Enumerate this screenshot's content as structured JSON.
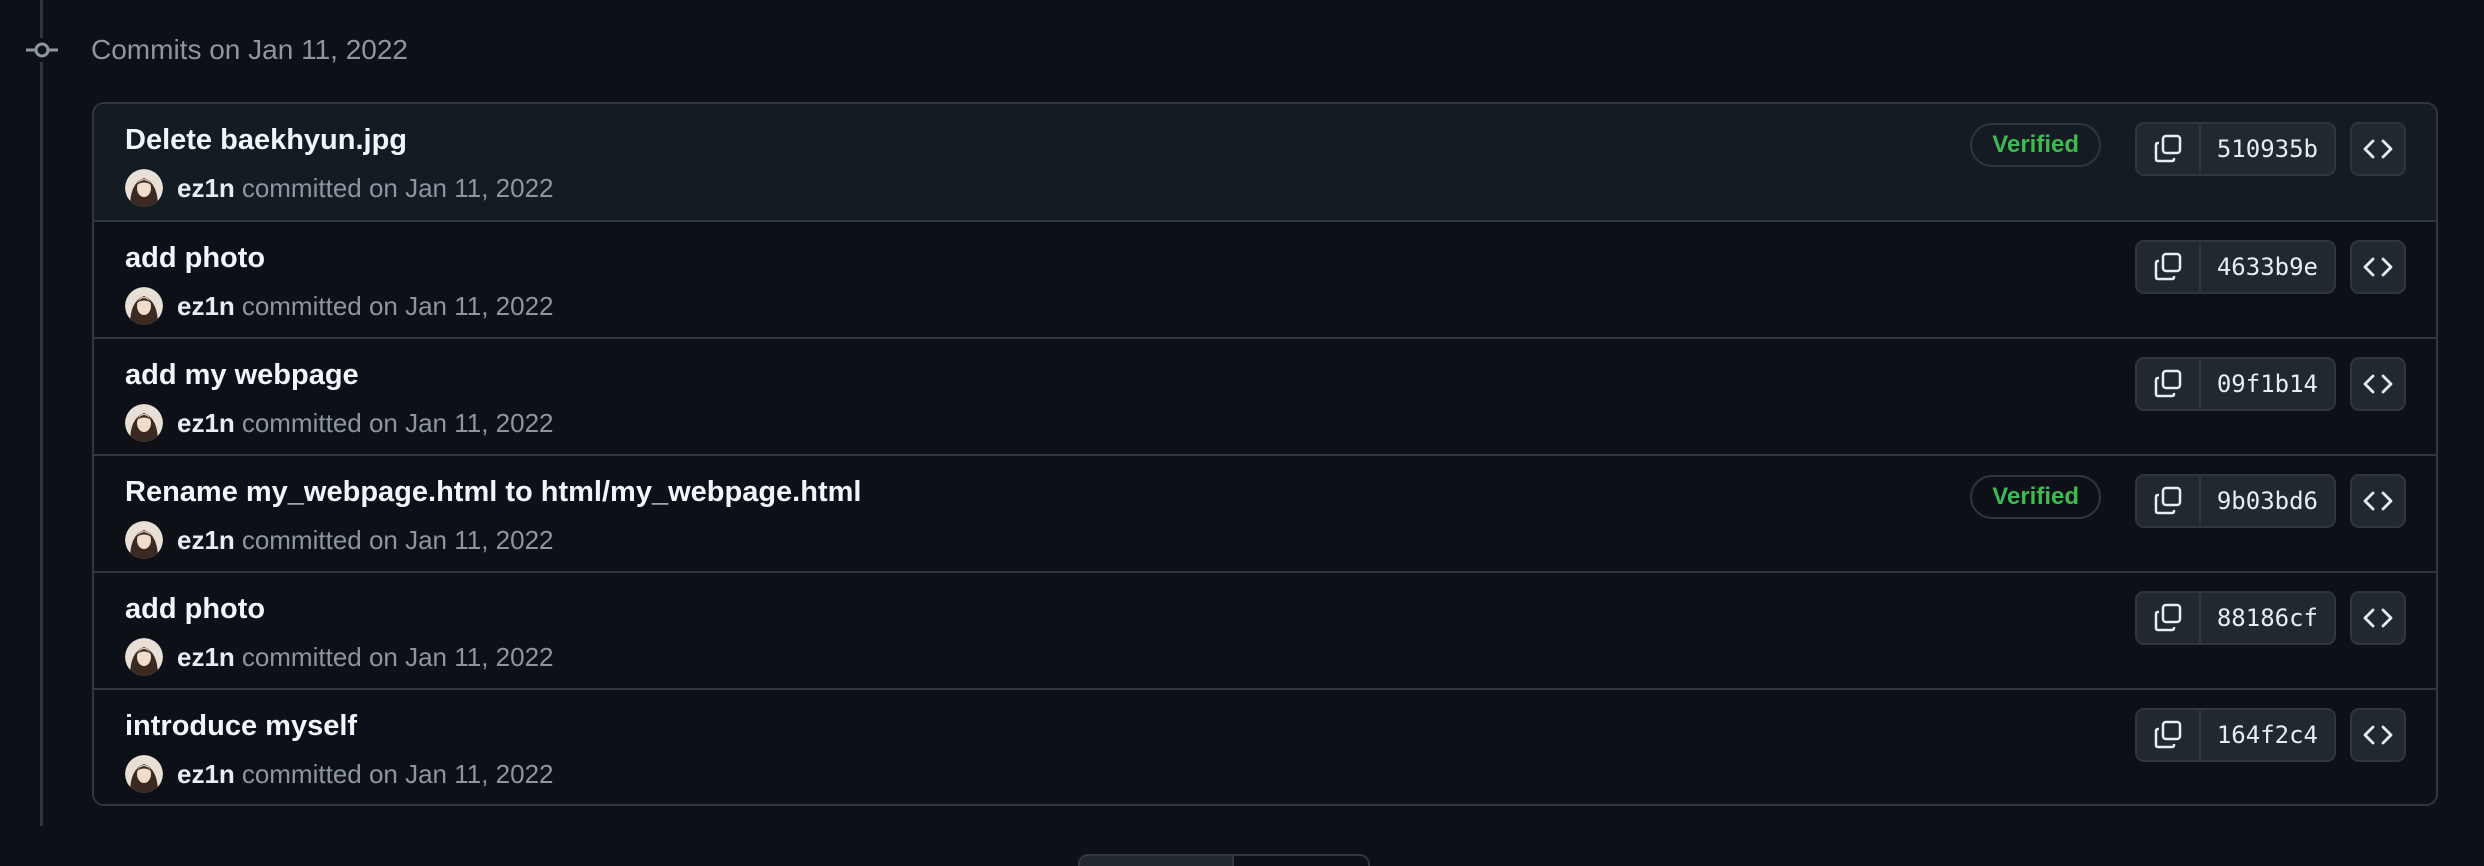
{
  "group": {
    "header": "Commits on Jan 11, 2022"
  },
  "commits": [
    {
      "title": "Delete baekhyun.jpg",
      "author": "ez1n",
      "meta": "committed on Jan 11, 2022",
      "verified": "Verified",
      "sha": "510935b"
    },
    {
      "title": "add photo",
      "author": "ez1n",
      "meta": "committed on Jan 11, 2022",
      "sha": "4633b9e"
    },
    {
      "title": "add my webpage",
      "author": "ez1n",
      "meta": "committed on Jan 11, 2022",
      "sha": "09f1b14"
    },
    {
      "title": "Rename my_webpage.html to html/my_webpage.html",
      "author": "ez1n",
      "meta": "committed on Jan 11, 2022",
      "verified": "Verified",
      "sha": "9b03bd6"
    },
    {
      "title": "add photo",
      "author": "ez1n",
      "meta": "committed on Jan 11, 2022",
      "sha": "88186cf"
    },
    {
      "title": "introduce myself",
      "author": "ez1n",
      "meta": "committed on Jan 11, 2022",
      "sha": "164f2c4"
    }
  ],
  "icons": {
    "timeline": "git-commit-icon",
    "copy": "copy-icon",
    "browse": "code-icon",
    "avatar": "avatar"
  },
  "colors": {
    "background": "#0d1117",
    "row_highlight": "#151b23",
    "border": "#30363d",
    "verified": "#3fb950",
    "muted_text": "#8d96a0"
  }
}
